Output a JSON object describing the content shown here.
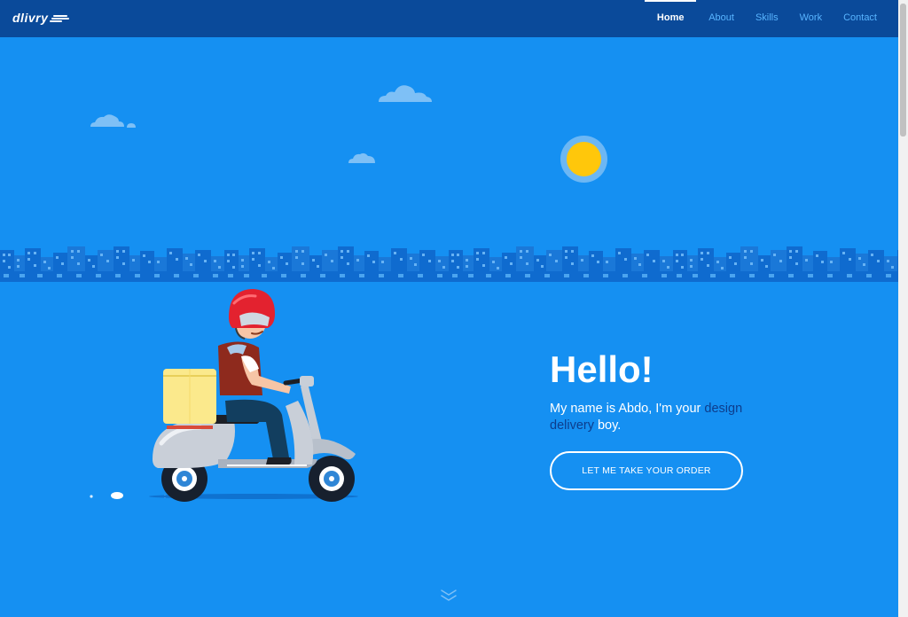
{
  "brand": {
    "logo_text": "dlivry"
  },
  "nav": {
    "items": [
      {
        "label": "Home",
        "active": true
      },
      {
        "label": "About"
      },
      {
        "label": "Skills"
      },
      {
        "label": "Work"
      },
      {
        "label": "Contact"
      }
    ]
  },
  "hero": {
    "title": "Hello!",
    "subtitle_before": "My name is Abdo, I'm your ",
    "subtitle_highlight": "design delivery",
    "subtitle_after": " boy.",
    "cta_label": "LET ME TAKE YOUR ORDER"
  },
  "icons": {
    "scroll_down": "chevron-down-icon",
    "sun": "sun-icon",
    "cloud": "cloud-icon",
    "scooter": "delivery-scooter-illustration"
  },
  "colors": {
    "background": "#1590f2",
    "navbar": "#0a4a9a",
    "nav_link": "#58b4ff",
    "highlight_text": "#0d3d8c",
    "sun": "#ffc70b",
    "skyline": "#0f6bcf"
  }
}
